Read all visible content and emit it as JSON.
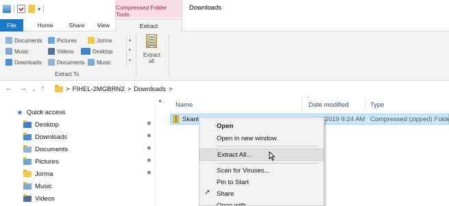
{
  "titlebar": {
    "context_tab_group": "Compressed Folder Tools",
    "window_title": "Downloads"
  },
  "tabs": [
    {
      "label": "File"
    },
    {
      "label": "Home"
    },
    {
      "label": "Share"
    },
    {
      "label": "View"
    },
    {
      "label": "Extract"
    }
  ],
  "ribbon": {
    "gallery": [
      {
        "label": "Documents",
        "icon": "documents-icon"
      },
      {
        "label": "Pictures",
        "icon": "pictures-icon"
      },
      {
        "label": "Jorma",
        "icon": "folder-icon"
      },
      {
        "label": "Music",
        "icon": "music-icon"
      },
      {
        "label": "Videos",
        "icon": "videos-icon"
      },
      {
        "label": "Desktop",
        "icon": "desktop-icon"
      },
      {
        "label": "Downloads",
        "icon": "downloads-icon"
      },
      {
        "label": "Documents",
        "icon": "documents-icon"
      },
      {
        "label": "Music",
        "icon": "music-icon"
      }
    ],
    "group_label": "Extract To",
    "extract_all_label": "Extract all"
  },
  "address": {
    "path": [
      "FIHEL-2MGBRN2",
      "Downloads"
    ],
    "separator": ">"
  },
  "navpane": {
    "items": [
      {
        "label": "Quick access",
        "icon": "star-icon",
        "pinned": false
      },
      {
        "label": "Desktop",
        "icon": "desktop-folder-icon",
        "pinned": true
      },
      {
        "label": "Downloads",
        "icon": "downloads-folder-icon",
        "pinned": true
      },
      {
        "label": "Documents",
        "icon": "documents-folder-icon",
        "pinned": true
      },
      {
        "label": "Pictures",
        "icon": "pictures-folder-icon",
        "pinned": true
      },
      {
        "label": "Jorma",
        "icon": "folder-icon",
        "pinned": true
      },
      {
        "label": "Music",
        "icon": "music-folder-icon",
        "pinned": false
      },
      {
        "label": "Videos",
        "icon": "videos-folder-icon",
        "pinned": false
      }
    ]
  },
  "files": {
    "columns": {
      "name": "Name",
      "date": "Date modified",
      "type": "Type"
    },
    "rows": [
      {
        "name": "Skanl",
        "date": "1/1/2019 9:24 AM",
        "type": "Compressed (zipped) Folder"
      }
    ]
  },
  "context_menu": {
    "items": [
      "Open",
      "Open in new window",
      "Extract All...",
      "Scan for Viruses...",
      "Pin to Start",
      "Share",
      "Open with..."
    ]
  },
  "colors": {
    "file_tab": "#1979ca",
    "context_tab_bg": "#f8dfe6",
    "context_tab_text": "#a01f4b",
    "selection": "#cce8ff"
  }
}
